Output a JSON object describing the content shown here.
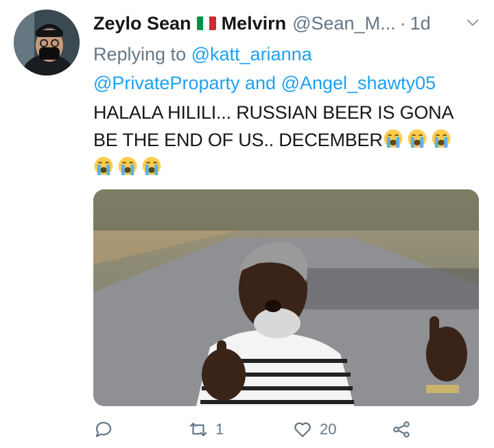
{
  "tweet": {
    "author_name": "Zeylo Sean",
    "author_name_2": "Melvirn",
    "handle": "@Sean_M...",
    "separator": "·",
    "time": "1d",
    "reply_prefix": "Replying to",
    "mentions": [
      "@katt_arianna",
      "@PrivateProparty",
      "@Angel_shawty05"
    ],
    "and_word": "and",
    "text_line1": "HALALA HILILI... RUSSIAN BEER IS GONA",
    "text_line2": "BE THE END OF US.. DECEMBER",
    "emoji": "loudly-crying-face",
    "flag_colors": [
      "#009246",
      "#ffffff",
      "#ce2b37"
    ]
  },
  "actions": {
    "reply_count": "",
    "retweet_count": "1",
    "like_count": "20"
  },
  "icons": {
    "caret": "chevron-down-icon",
    "reply": "comment-icon",
    "retweet": "retweet-icon",
    "like": "heart-icon",
    "share": "share-icon"
  },
  "colors": {
    "link": "#1da1f2",
    "secondary": "#657786",
    "text": "#14171a"
  }
}
